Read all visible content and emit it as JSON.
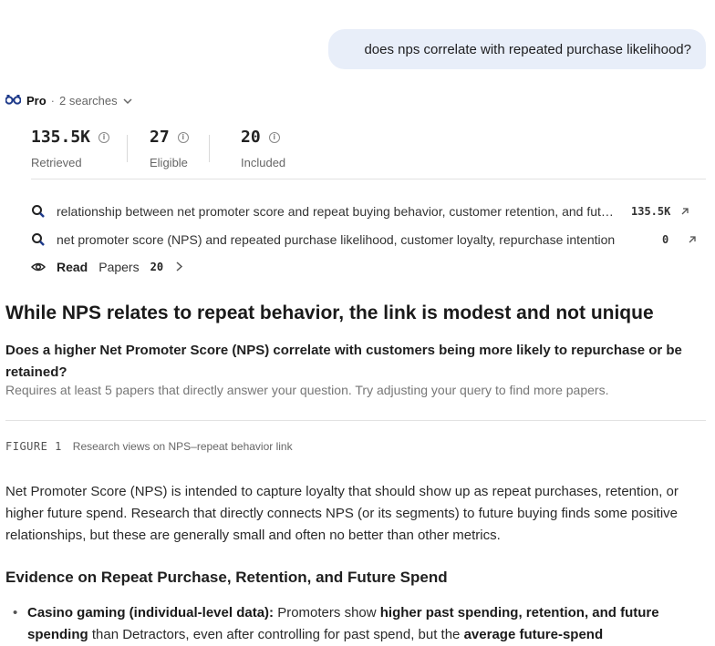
{
  "user_message": "does nps correlate with repeated purchase likelihood?",
  "pro": {
    "label": "Pro",
    "searches": "2 searches"
  },
  "stats": [
    {
      "value": "135.5K",
      "label": "Retrieved"
    },
    {
      "value": "27",
      "label": "Eligible"
    },
    {
      "value": "20",
      "label": "Included"
    }
  ],
  "queries": [
    {
      "text": "relationship between net promoter score and repeat buying behavior, customer retention, and future purchase behavior",
      "count": "135.5K"
    },
    {
      "text": "net promoter score (NPS) and repeated purchase likelihood, customer loyalty, repurchase intention",
      "count": "0"
    }
  ],
  "read": {
    "label": "Read",
    "papers_label": "Papers",
    "count": "20"
  },
  "headline": "While NPS relates to repeat behavior, the link is modest and not unique",
  "question": "Does a higher Net Promoter Score (NPS) correlate with customers being more likely to repurchase or be retained?",
  "note": "Requires at least 5 papers that directly answer your question. Try adjusting your query to find more papers.",
  "figure": {
    "number": "FIGURE 1",
    "caption": "Research views on NPS–repeat behavior link"
  },
  "paragraph": "Net Promoter Score (NPS) is intended to capture loyalty that should show up as repeat purchases, retention, or higher future spend. Research that directly connects NPS (or its segments) to future buying finds some positive relationships, but these are generally small and often no better than other metrics.",
  "section_heading": "Evidence on Repeat Purchase, Retention, and Future Spend",
  "bullet": {
    "lead": "Casino gaming (individual-level data):",
    "t1": " Promoters show ",
    "b1": "higher past spending, retention, and future spending",
    "t2": " than Detractors, even after controlling for past spend, but the ",
    "b2": "average future-spend"
  }
}
